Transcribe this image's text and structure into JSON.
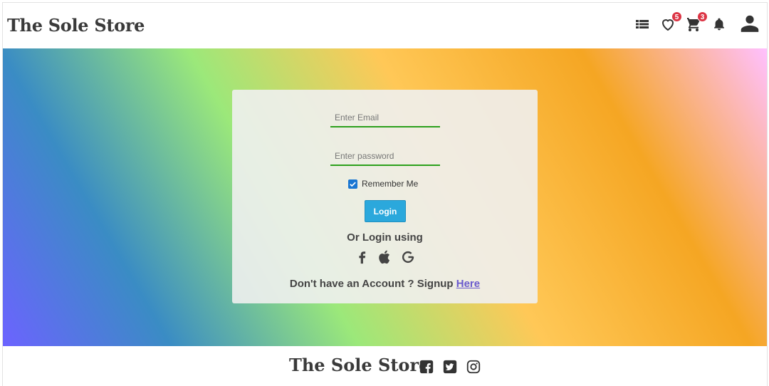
{
  "navbar": {
    "brand": "The Sole Store",
    "icons": {
      "list": "list-icon",
      "wishlist": "heart-icon",
      "cart": "cart-icon",
      "notifications": "bell-icon",
      "account": "user-icon"
    },
    "wishlist_count": "5",
    "cart_count": "3"
  },
  "login": {
    "email_placeholder": "Enter Email",
    "password_placeholder": "Enter password",
    "remember_label": "Remember Me",
    "remember_checked": true,
    "login_label": "Login",
    "or_login_text": "Or Login using",
    "social": [
      "facebook-icon",
      "apple-icon",
      "google-icon"
    ],
    "signup_text": "Don't have an Account ? Signup",
    "signup_link": "Here"
  },
  "footer": {
    "brand": "The Sole Store",
    "social": [
      "facebook-square-icon",
      "twitter-square-icon",
      "instagram-icon"
    ]
  },
  "colors": {
    "badge": "#dc3545",
    "login_button": "#2ba8dc",
    "field_underline": "#2ca01c",
    "link": "#6a5acd",
    "checkbox": "#1976d2"
  }
}
